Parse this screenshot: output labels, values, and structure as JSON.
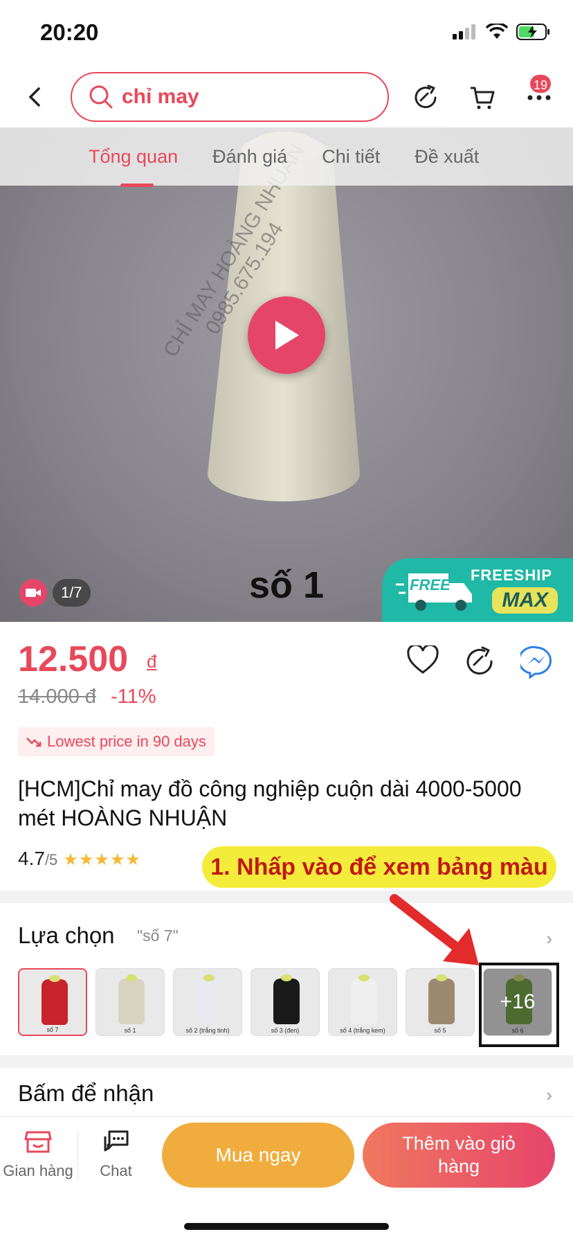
{
  "status_bar": {
    "time": "20:20"
  },
  "search": {
    "query": "chỉ may"
  },
  "header": {
    "cart_count": "19"
  },
  "tabs": [
    {
      "label": "Tổng quan"
    },
    {
      "label": "Đánh giá"
    },
    {
      "label": "Chi tiết"
    },
    {
      "label": "Đề xuất"
    }
  ],
  "media": {
    "counter": "1/7",
    "caption": "số 1",
    "watermark_line1": "CHỈ MAY HOÀNG NHUẬN",
    "watermark_line2": "0985.675.194",
    "freeship_label": "FREESHIP",
    "freeship_max": "MAX",
    "free_tag": "FREE"
  },
  "price": {
    "current": "12.500",
    "currency": "đ",
    "original": "14.000 đ",
    "discount": "-11%",
    "lowest_badge": "Lowest price in 90 days"
  },
  "product": {
    "title": "[HCM]Chỉ may đồ công nghiệp cuộn dài 4000-5000 mét HOÀNG NHUẬN",
    "rating": "4.7",
    "rating_suffix": "/5",
    "stars": "★★★★★"
  },
  "annotation": {
    "text": "1. Nhấp vào để xem bảng màu"
  },
  "options": {
    "title": "Lựa chọn",
    "selected": "\"số 7\"",
    "swatches": [
      {
        "label": "số 7",
        "color": "#c8222c"
      },
      {
        "label": "số 1",
        "color": "#d9d3c2"
      },
      {
        "label": "số 2 (trắng tinh)",
        "color": "#e8e8ee"
      },
      {
        "label": "số 3 (đen)",
        "color": "#1a1a1a"
      },
      {
        "label": "số 4 (trắng kem)",
        "color": "#efefef"
      },
      {
        "label": "số 5",
        "color": "#9c8a70"
      },
      {
        "label": "số 6",
        "color": "#6aa33a",
        "more": "+16"
      }
    ]
  },
  "receive": {
    "title": "Bấm để nhận"
  },
  "bottom_bar": {
    "shop_label": "Gian hàng",
    "chat_label": "Chat",
    "buy_now": "Mua ngay",
    "add_to_cart": "Thêm vào giỏ hàng"
  },
  "colors": {
    "accent": "#e8485a",
    "buy": "#f1ac3e",
    "annotation_bg": "#f4ec3b"
  }
}
